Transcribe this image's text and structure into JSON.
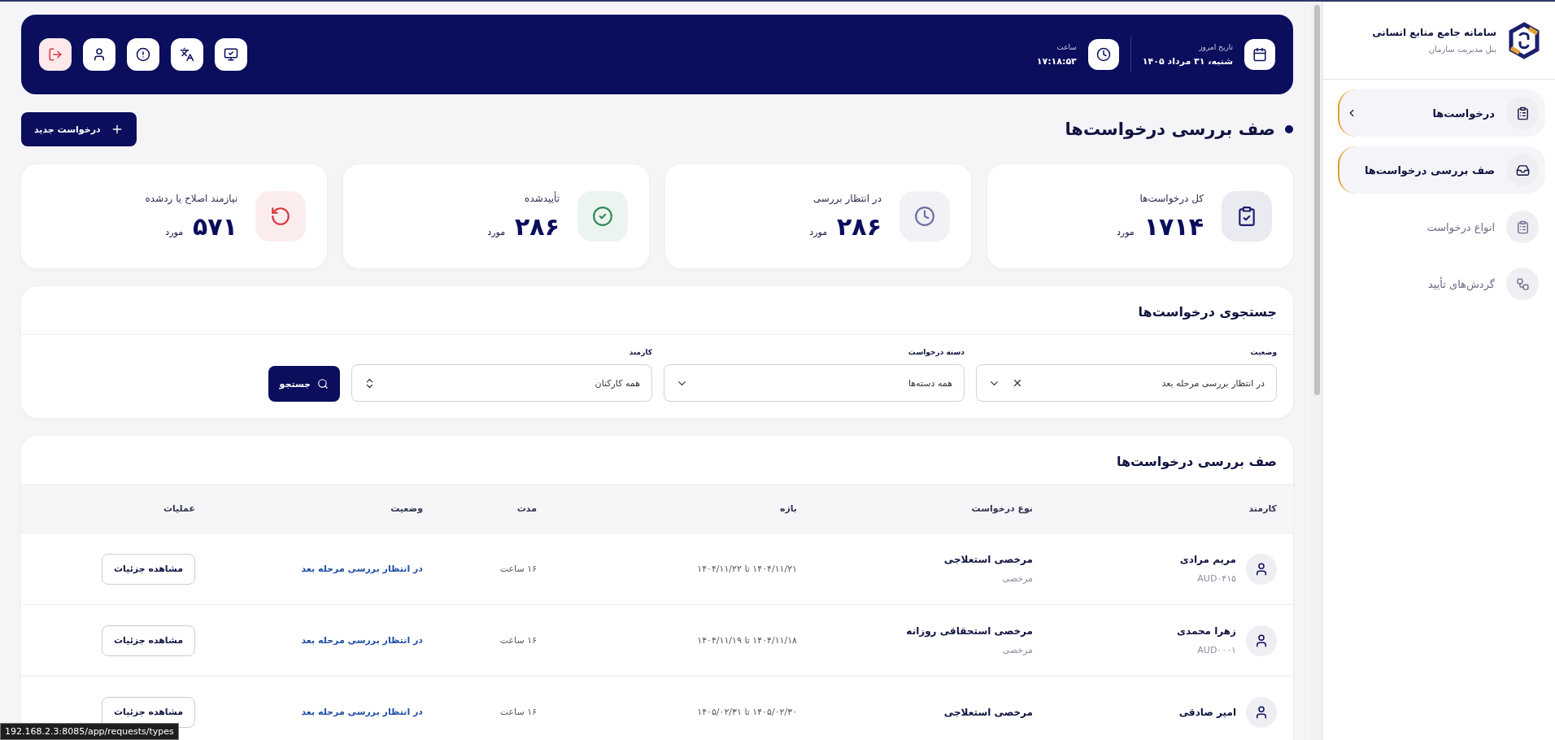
{
  "sidebar": {
    "app_title": "سامانه جامع منابع انسانی",
    "app_subtitle": "پنل مدیریت سازمان",
    "items": [
      {
        "label": "درخواست‌ها",
        "expanded": true,
        "children": [
          {
            "label": "صف بررسی درخواست‌ها",
            "selected": true
          },
          {
            "label": "انواع درخواست",
            "selected": false
          },
          {
            "label": "گردش‌های تأیید",
            "selected": false
          }
        ]
      }
    ]
  },
  "header": {
    "date_label": "تاریخ امروز",
    "date": "شنبه، ۳۱ مرداد ۱۴۰۵",
    "time_label": "ساعت",
    "time": "۱۷:۱۸:۵۳"
  },
  "page_title": "صف بررسی درخواست‌ها",
  "new_request_button": "درخواست جدید",
  "stats": [
    {
      "label": "کل درخواست‌ها",
      "value": "۱۷۱۴",
      "unit": "مورد",
      "color": "#1b1f6b"
    },
    {
      "label": "در انتظار بررسی",
      "value": "۲۸۶",
      "unit": "مورد",
      "color": "#6b6fa0"
    },
    {
      "label": "تأییدشده",
      "value": "۲۸۶",
      "unit": "مورد",
      "color": "#2e8b57"
    },
    {
      "label": "نیازمند اصلاح یا ردشده",
      "value": "۵۷۱",
      "unit": "مورد",
      "color": "#d9363e"
    }
  ],
  "search": {
    "title": "جستجوی درخواست‌ها",
    "filters": [
      {
        "label": "وضعیت",
        "value": "در انتظار بررسی مرحله بعد",
        "kind": "select",
        "clearable": true
      },
      {
        "label": "دسته درخواست",
        "value": "همه دسته‌ها",
        "kind": "select",
        "clearable": false
      },
      {
        "label": "کارمند",
        "value": "همه کارکنان",
        "kind": "combobox",
        "clearable": false
      }
    ],
    "button": "جستجو"
  },
  "table": {
    "title": "صف بررسی درخواست‌ها",
    "columns": [
      "کارمند",
      "نوع درخواست",
      "بازه",
      "مدت",
      "وضعیت",
      "عملیات"
    ],
    "rows": [
      {
        "name": "مریم مرادی",
        "employee_id": "AUD۰۴۱۵",
        "type": "مرخصی استعلاجی",
        "category": "مرخصی",
        "range": "۱۴۰۴/۱۱/۲۱ تا ۱۴۰۴/۱۱/۲۲",
        "duration": "۱۶ ساعت",
        "status": "در انتظار بررسی مرحله بعد",
        "action": "مشاهده جزئیات"
      },
      {
        "name": "زهرا محمدی",
        "employee_id": "AUD۰۰۰۱",
        "type": "مرخصی استحقاقی روزانه",
        "category": "مرخصی",
        "range": "۱۴۰۴/۱۱/۱۸ تا ۱۴۰۴/۱۱/۱۹",
        "duration": "۱۶ ساعت",
        "status": "در انتظار بررسی مرحله بعد",
        "action": "مشاهده جزئیات"
      },
      {
        "name": "امیر صادقی",
        "type": "مرخصی استعلاجی",
        "range": "۱۴۰۵/۰۲/۳۰ تا ۱۴۰۵/۰۲/۳۱",
        "duration": "۱۶ ساعت",
        "status": "در انتظار بررسی مرحله بعد",
        "action": "مشاهده جزئیات"
      }
    ]
  },
  "browser_status": "192.168.2.3:8085/app/requests/types"
}
